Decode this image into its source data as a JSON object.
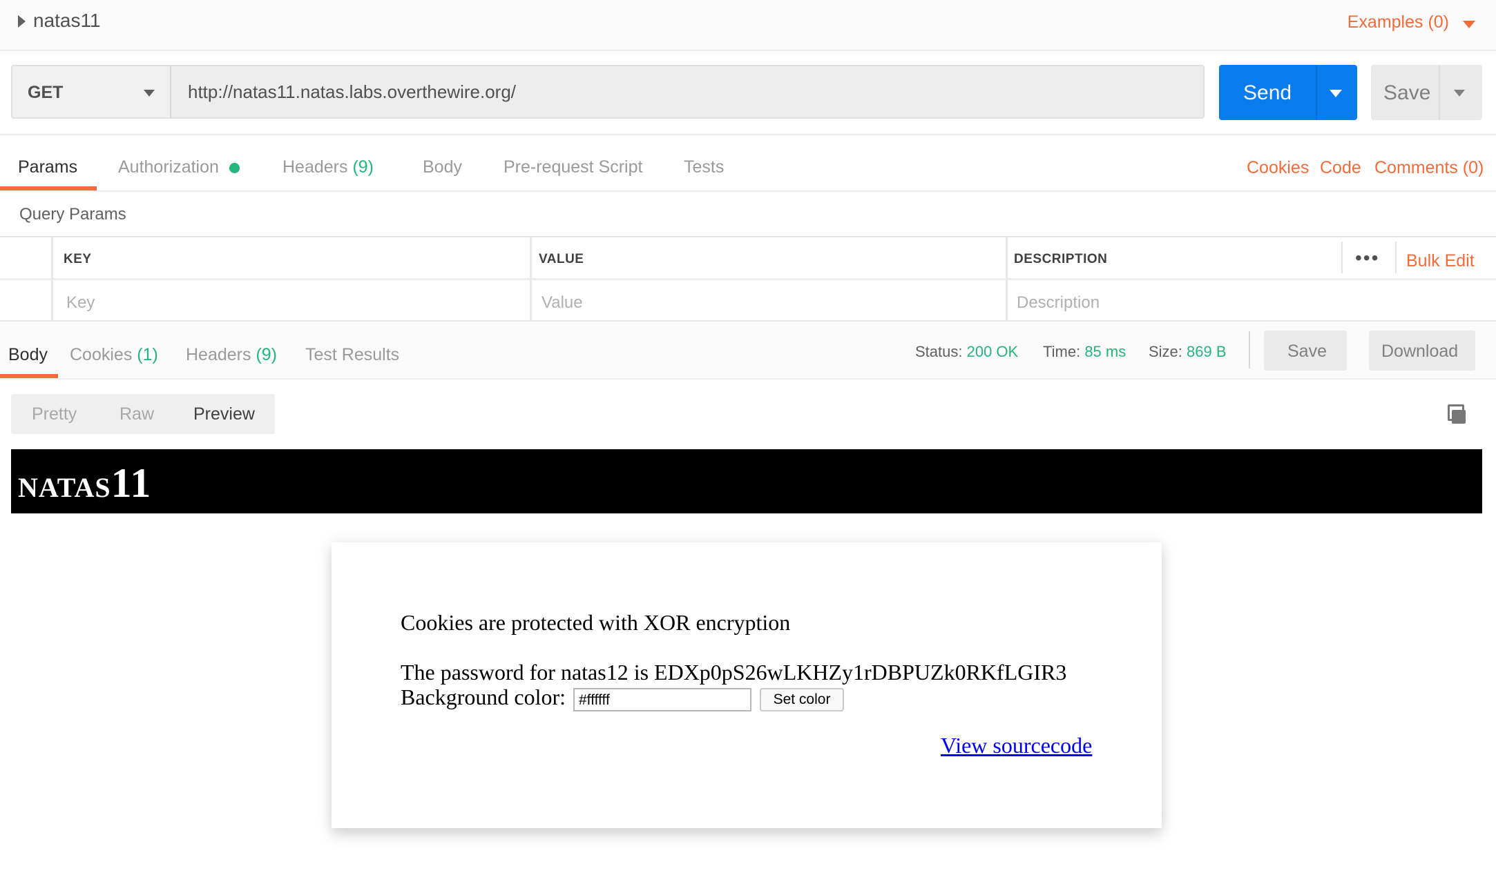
{
  "request": {
    "name": "natas11",
    "examples_label": "Examples (0)",
    "method": "GET",
    "url": "http://natas11.natas.labs.overthewire.org/",
    "send_label": "Send",
    "save_label": "Save"
  },
  "request_tabs": {
    "params": "Params",
    "authorization": "Authorization",
    "headers": "Headers",
    "headers_count": "(9)",
    "body": "Body",
    "prerequest": "Pre-request Script",
    "tests": "Tests",
    "cookies": "Cookies",
    "code": "Code",
    "comments": "Comments (0)"
  },
  "query_params": {
    "title": "Query Params",
    "columns": [
      "KEY",
      "VALUE",
      "DESCRIPTION"
    ],
    "placeholders": [
      "Key",
      "Value",
      "Description"
    ],
    "more": "•••",
    "bulk_edit": "Bulk Edit"
  },
  "response_tabs": {
    "body": "Body",
    "cookies": "Cookies",
    "cookies_count": "(1)",
    "headers": "Headers",
    "headers_count": "(9)",
    "test_results": "Test Results"
  },
  "response_status": {
    "status_label": "Status:",
    "status_value": "200 OK",
    "time_label": "Time:",
    "time_value": "85 ms",
    "size_label": "Size:",
    "size_value": "869 B",
    "save_label": "Save",
    "download_label": "Download"
  },
  "view_modes": {
    "pretty": "Pretty",
    "raw": "Raw",
    "preview": "Preview",
    "selected": "Preview"
  },
  "preview": {
    "title_small": "NATAS",
    "title_big": "11",
    "xor_text": "Cookies are protected with XOR encryption",
    "password_text": "The password for natas12 is EDXp0pS26wLKHZy1rDBPUZk0RKfLGIR3",
    "bg_label": "Background color:",
    "bg_value": "#ffffff",
    "set_color_label": "Set color",
    "source_link": "View sourcecode"
  },
  "colors": {
    "accent": "#f26b3a",
    "send": "#097bed",
    "success": "#26b47f"
  },
  "icons": [
    "collapse-caret-icon",
    "dropdown-caret-icon",
    "status-dot-icon",
    "more-icon",
    "copy-icon"
  ]
}
